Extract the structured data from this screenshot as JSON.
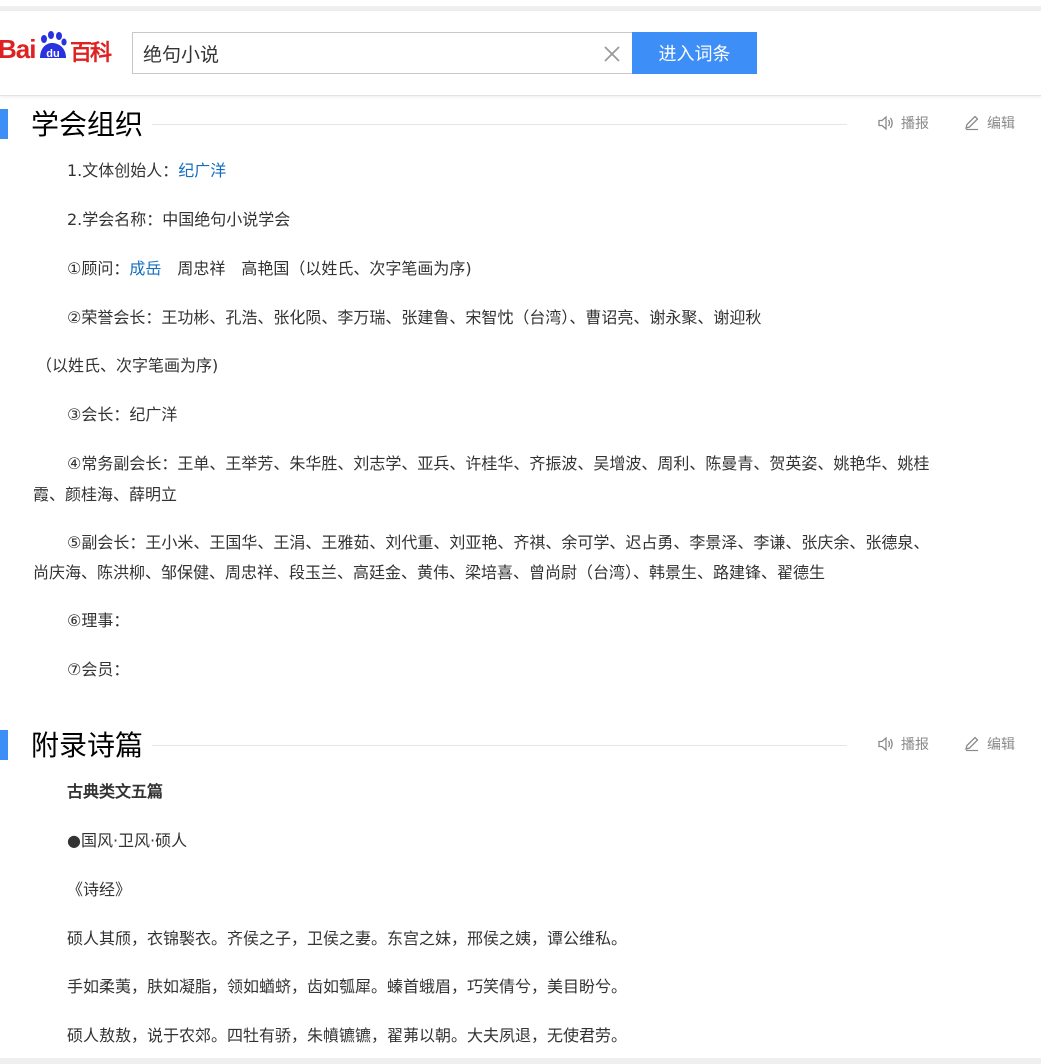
{
  "search": {
    "brand_bai": "Bai",
    "brand_du": "du",
    "brand_baike": "百科",
    "query": "绝句小说",
    "submit_label": "进入词条"
  },
  "sections": [
    {
      "title": "学会组织",
      "play_label": "播报",
      "edit_label": "编辑"
    },
    {
      "title": "附录诗篇",
      "play_label": "播报",
      "edit_label": "编辑"
    }
  ],
  "org": {
    "p1_label": "1.文体创始人：",
    "p1_link": "纪广洋",
    "p2": "2.学会名称：中国绝句小说学会",
    "p3_label": "①顾问：",
    "p3_link": "成岳",
    "p3_rest": "　周忠祥　高艳国（以姓氏、次字笔画为序)",
    "p4": "②荣誉会长：王功彬、孔浩、张化陨、李万瑞、张建鲁、宋智忱（台湾）、曹诏亮、谢永聚、谢迎秋",
    "p5": "（以姓氏、次字笔画为序)",
    "p6": "③会长：纪广洋",
    "p7_line1": "④常务副会长：王单、王举芳、朱华胜、刘志学、亚兵、许桂华、齐振波、吴增波、周利、陈曼青、贺英姿、姚艳华、姚桂",
    "p7_line2": "霞、颜桂海、薛明立",
    "p8_line1": "⑤副会长：王小米、王国华、王涓、王雅茹、刘代重、刘亚艳、齐祺、余可学、迟占勇、李景泽、李谦、张庆余、张德泉、",
    "p8_line2": "尚庆海、陈洪柳、邹保健、周忠祥、段玉兰、高廷金、黄伟、梁培喜、曾尚尉（台湾）、韩景生、路建锋、翟德生",
    "p9": "⑥理事：",
    "p10": "⑦会员："
  },
  "poems": {
    "heading": "古典类文五篇",
    "title1": "●国风·卫风·硕人",
    "source1": "《诗经》",
    "line1": "硕人其颀，衣锦褧衣。齐侯之子，卫侯之妻。东宫之妹，邢侯之姨，谭公维私。",
    "line2": "手如柔荑，肤如凝脂，领如蝤蛴，齿如瓠犀。螓首蛾眉，巧笑倩兮，美目盼兮。",
    "line3": "硕人敖敖，说于农郊。四牡有骄，朱幩镳镳，翟茀以朝。大夫夙退，无使君劳。"
  }
}
